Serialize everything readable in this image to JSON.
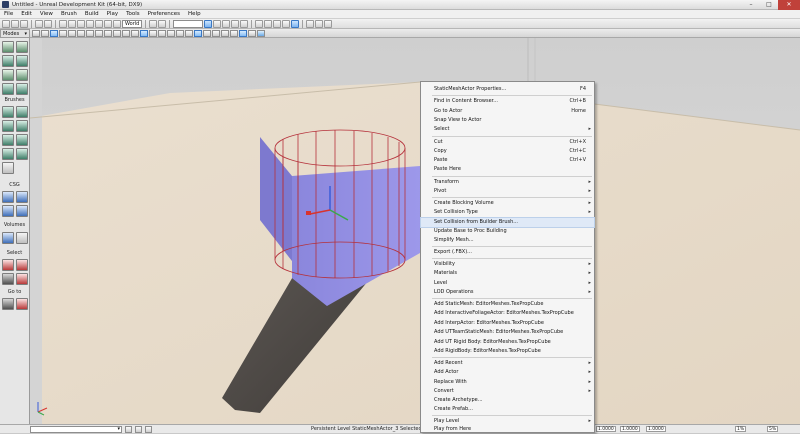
{
  "window": {
    "title": "Untitled - Unreal Development Kit (64-bit, DX9)",
    "min_label": "–",
    "max_label": "□",
    "close_label": "✕"
  },
  "menubar": {
    "items": [
      "File",
      "Edit",
      "View",
      "Brush",
      "Build",
      "Play",
      "Tools",
      "Preferences",
      "Help"
    ]
  },
  "toolbar": {
    "grid_combo": "World"
  },
  "modes": {
    "label": "Modes",
    "arrow": "▾"
  },
  "palette": {
    "brushes_label": "Brushes",
    "csg_label": "CSG",
    "volumes_label": "Volumes",
    "select_label": "Select",
    "goto_label": "Go to"
  },
  "statusbar": {
    "level_text": "Persistent Level StaticMeshActor_3 Selected (32 Tris,...",
    "field1": "1.0000",
    "field2": "1.0000",
    "field3": "1.0000",
    "pct": "1%",
    "pct2": "5%"
  },
  "context_menu": {
    "items": [
      {
        "label": "StaticMeshActor Properties...",
        "shortcut": "F4",
        "arrow": ""
      },
      {
        "label": "Find in Content Browser...",
        "shortcut": "Ctrl+B",
        "arrow": ""
      },
      {
        "label": "Go to Actor",
        "shortcut": "Home",
        "arrow": ""
      },
      {
        "label": "Snap View to Actor",
        "shortcut": "",
        "arrow": ""
      },
      {
        "label": "Select",
        "shortcut": "",
        "arrow": "▸"
      },
      {
        "label": "Cut",
        "shortcut": "Ctrl+X",
        "arrow": ""
      },
      {
        "label": "Copy",
        "shortcut": "Ctrl+C",
        "arrow": ""
      },
      {
        "label": "Paste",
        "shortcut": "Ctrl+V",
        "arrow": ""
      },
      {
        "label": "Paste Here",
        "shortcut": "",
        "arrow": ""
      },
      {
        "label": "Transform",
        "shortcut": "",
        "arrow": "▸"
      },
      {
        "label": "Pivot",
        "shortcut": "",
        "arrow": "▸"
      },
      {
        "label": "Create Blocking Volume",
        "shortcut": "",
        "arrow": "▸"
      },
      {
        "label": "Set Collision Type",
        "shortcut": "",
        "arrow": "▸"
      },
      {
        "label": "Set Collision from Builder Brush...",
        "shortcut": "",
        "arrow": ""
      },
      {
        "label": "Update Base to Proc Building",
        "shortcut": "",
        "arrow": ""
      },
      {
        "label": "Simplify Mesh...",
        "shortcut": "",
        "arrow": ""
      },
      {
        "label": "Export (.FBX)...",
        "shortcut": "",
        "arrow": ""
      },
      {
        "label": "Visibility",
        "shortcut": "",
        "arrow": "▸"
      },
      {
        "label": "Materials",
        "shortcut": "",
        "arrow": "▸"
      },
      {
        "label": "Level",
        "shortcut": "",
        "arrow": "▸"
      },
      {
        "label": "LOD Operations",
        "shortcut": "",
        "arrow": "▸"
      },
      {
        "label": "Add StaticMesh: EditorMeshes.TexPropCube",
        "shortcut": "",
        "arrow": ""
      },
      {
        "label": "Add InteractiveFoliageActor: EditorMeshes.TexPropCube",
        "shortcut": "",
        "arrow": ""
      },
      {
        "label": "Add InterpActor: EditorMeshes.TexPropCube",
        "shortcut": "",
        "arrow": ""
      },
      {
        "label": "Add UTTeamStaticMesh: EditorMeshes.TexPropCube",
        "shortcut": "",
        "arrow": ""
      },
      {
        "label": "Add UT Rigid Body: EditorMeshes.TexPropCube",
        "shortcut": "",
        "arrow": ""
      },
      {
        "label": "Add RigidBody: EditorMeshes.TexPropCube",
        "shortcut": "",
        "arrow": ""
      },
      {
        "label": "Add Recent",
        "shortcut": "",
        "arrow": "▸"
      },
      {
        "label": "Add Actor",
        "shortcut": "",
        "arrow": "▸"
      },
      {
        "label": "Replace With",
        "shortcut": "",
        "arrow": "▸"
      },
      {
        "label": "Convert",
        "shortcut": "",
        "arrow": "▸"
      },
      {
        "label": "Create Archetype...",
        "shortcut": "",
        "arrow": ""
      },
      {
        "label": "Create Prefab...",
        "shortcut": "",
        "arrow": ""
      },
      {
        "label": "Play Level",
        "shortcut": "",
        "arrow": "▸"
      },
      {
        "label": "Play from Here",
        "shortcut": "",
        "arrow": ""
      }
    ]
  },
  "colors": {
    "floor": "#e8dccb",
    "sky": "#d0d0d0",
    "mesh": "#8c88e0",
    "wire": "#b5303a",
    "highlight": "#dfe9f7"
  }
}
